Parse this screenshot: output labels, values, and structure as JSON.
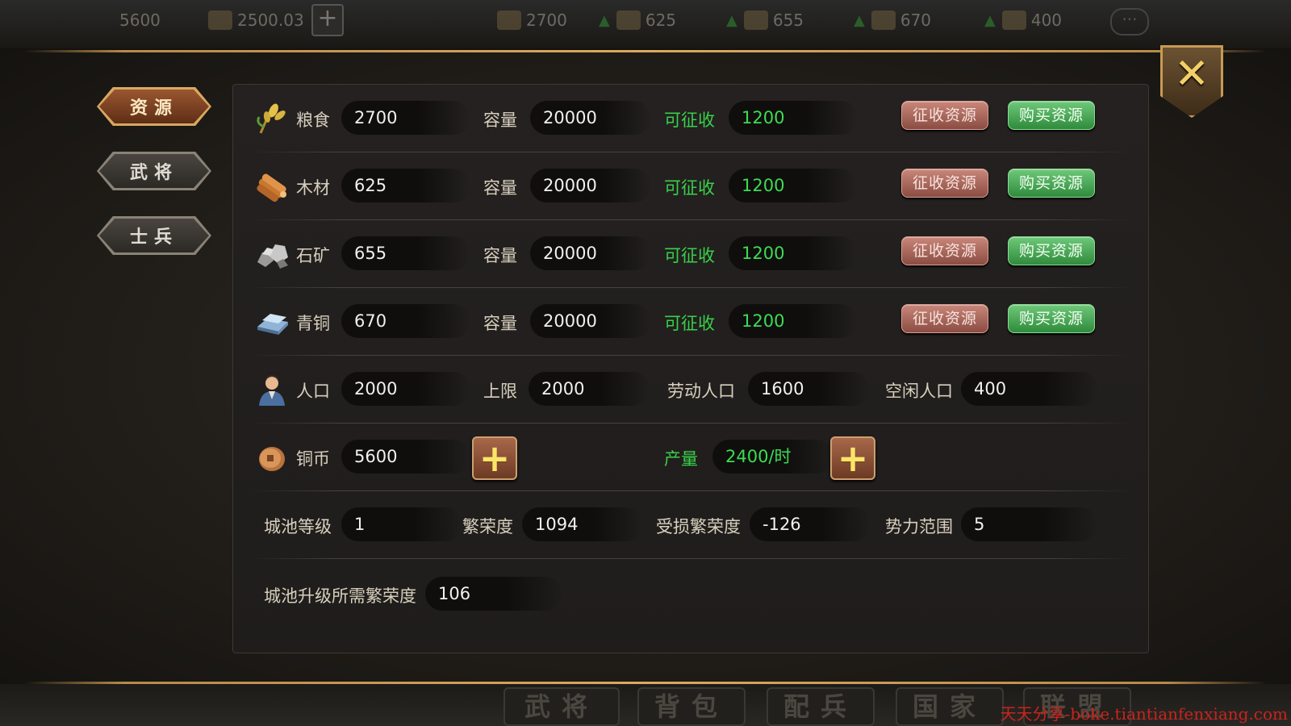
{
  "topbar": {
    "copper": "5600",
    "gold": "2500.03",
    "food": "2700",
    "wood": "625",
    "stone": "655",
    "bronze": "670",
    "population": "400",
    "more": "···"
  },
  "tabs": [
    {
      "label": "资源",
      "active": true
    },
    {
      "label": "武将",
      "active": false
    },
    {
      "label": "士兵",
      "active": false
    }
  ],
  "resources": [
    {
      "icon": "grain-icon",
      "name": "粮食",
      "amount": "2700",
      "capacity_label": "容量",
      "capacity": "20000",
      "collectable_label": "可征收",
      "collectable": "1200",
      "collect_btn": "征收资源",
      "buy_btn": "购买资源"
    },
    {
      "icon": "wood-icon",
      "name": "木材",
      "amount": "625",
      "capacity_label": "容量",
      "capacity": "20000",
      "collectable_label": "可征收",
      "collectable": "1200",
      "collect_btn": "征收资源",
      "buy_btn": "购买资源"
    },
    {
      "icon": "stone-icon",
      "name": "石矿",
      "amount": "655",
      "capacity_label": "容量",
      "capacity": "20000",
      "collectable_label": "可征收",
      "collectable": "1200",
      "collect_btn": "征收资源",
      "buy_btn": "购买资源"
    },
    {
      "icon": "bronze-icon",
      "name": "青铜",
      "amount": "670",
      "capacity_label": "容量",
      "capacity": "20000",
      "collectable_label": "可征收",
      "collectable": "1200",
      "collect_btn": "征收资源",
      "buy_btn": "购买资源"
    }
  ],
  "population": {
    "icon": "person-icon",
    "label": "人口",
    "value": "2000",
    "limit_label": "上限",
    "limit": "2000",
    "labor_label": "劳动人口",
    "labor": "1600",
    "idle_label": "空闲人口",
    "idle": "400"
  },
  "coins": {
    "icon": "coin-icon",
    "label": "铜币",
    "value": "5600",
    "output_label": "产量",
    "output": "2400/时"
  },
  "city": {
    "level_label": "城池等级",
    "level": "1",
    "prosperity_label": "繁荣度",
    "prosperity": "1094",
    "damaged_label": "受损繁荣度",
    "damaged": "-126",
    "range_label": "势力范围",
    "range": "5",
    "upgrade_label": "城池升级所需繁荣度",
    "upgrade": "106"
  },
  "bottom_nav": [
    "武将",
    "背包",
    "配兵",
    "国家",
    "联盟"
  ],
  "watermark": "天天分享-boke.tiantianfenxiang.com",
  "colors": {
    "accent_gold": "#d9aa5e",
    "green": "#38d04a",
    "collect_btn": "#b06a5c",
    "buy_btn": "#44a852"
  }
}
